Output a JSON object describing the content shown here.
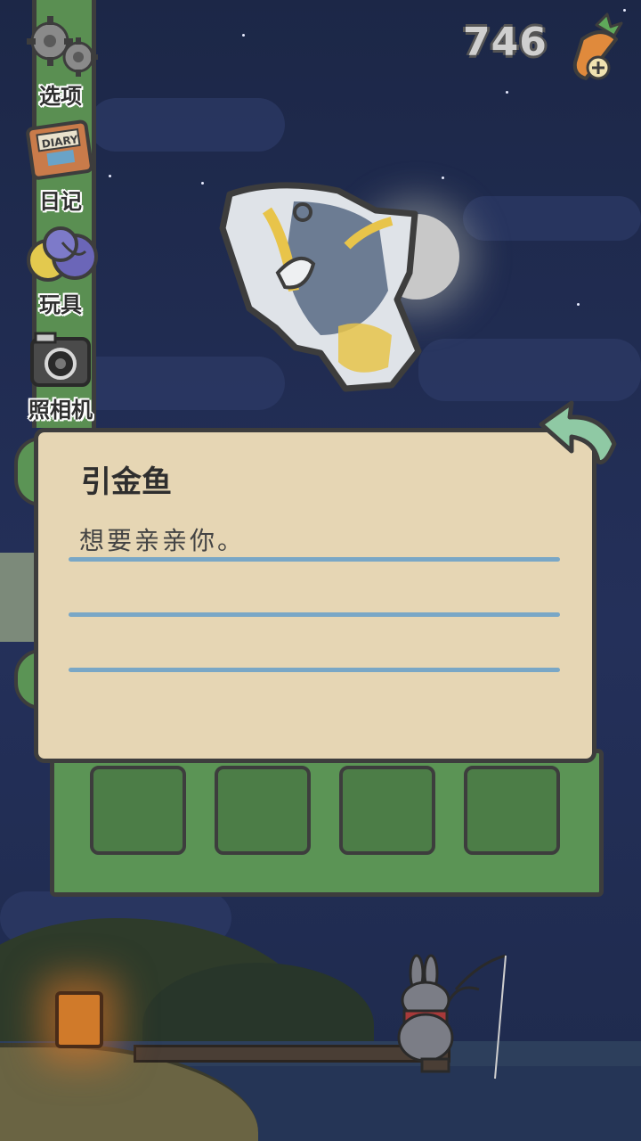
{
  "menu": {
    "items": [
      {
        "label": "选项",
        "icon": "gear-icon"
      },
      {
        "label": "日记",
        "icon": "diary-book-icon",
        "icon_text": "DIARY"
      },
      {
        "label": "玩具",
        "icon": "yarn-balls-icon"
      },
      {
        "label": "照相机",
        "icon": "camera-icon"
      }
    ]
  },
  "currency": {
    "amount": "746",
    "icon": "carrot-plus-icon"
  },
  "fish_card": {
    "name": "引金鱼",
    "description": "想要亲亲你。",
    "back_icon": "back-arrow-icon"
  },
  "inventory": {
    "slot_count": 4
  },
  "colors": {
    "panel_green": "#5b9455",
    "card_bg": "#e6d6b4",
    "rule_blue": "#79a7c6",
    "outline": "#3d3d3d"
  }
}
